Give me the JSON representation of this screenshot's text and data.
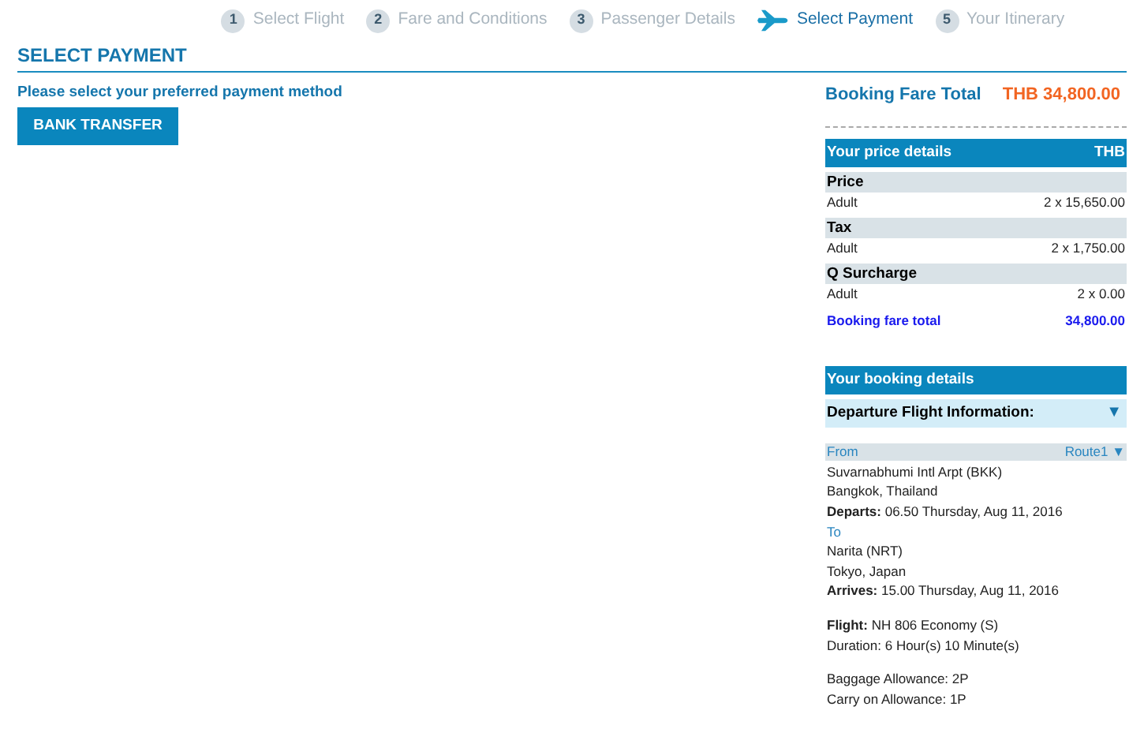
{
  "steps": [
    {
      "number": "1",
      "label": "Select Flight",
      "selected": false
    },
    {
      "number": "2",
      "label": "Fare and Conditions",
      "selected": false
    },
    {
      "number": "3",
      "label": "Passenger Details",
      "selected": false
    },
    {
      "label": "Select Payment",
      "selected": true
    },
    {
      "number": "5",
      "label": "Your Itinerary",
      "selected": false
    }
  ],
  "page_title": "SELECT PAYMENT",
  "payment": {
    "prompt": "Please select your preferred payment method",
    "buttons": [
      "BANK TRANSFER"
    ]
  },
  "booking_total": {
    "label": "Booking Fare Total",
    "amount": "THB 34,800.00"
  },
  "price_details": {
    "title": "Your price details",
    "currency": "THB",
    "groups": [
      {
        "name": "Price",
        "rows": [
          {
            "label": "Adult",
            "value": "2 x 15,650.00"
          }
        ]
      },
      {
        "name": "Tax",
        "rows": [
          {
            "label": "Adult",
            "value": "2 x 1,750.00"
          }
        ]
      },
      {
        "name": "Q Surcharge",
        "rows": [
          {
            "label": "Adult",
            "value": "2 x 0.00"
          }
        ]
      }
    ],
    "total": {
      "label": "Booking fare total",
      "value": "34,800.00"
    }
  },
  "booking_details": {
    "title": "Your booking details",
    "section": "Departure Flight Information:",
    "section_toggle": "▼",
    "from_label": "From",
    "route": "Route1 ▼",
    "blocks": [
      {
        "lines": [
          {
            "kind": "text",
            "text": "Suvarnabhumi Intl Arpt (BKK)"
          },
          {
            "kind": "text",
            "text": "Bangkok, Thailand"
          },
          {
            "kind": "text",
            "text": "**Departs:** 06.50 Thursday, Aug 11, 2016"
          },
          {
            "kind": "label",
            "text": "To"
          },
          {
            "kind": "text",
            "text": "Narita (NRT)"
          },
          {
            "kind": "text",
            "text": "Tokyo, Japan"
          },
          {
            "kind": "text",
            "text": "**Arrives:** 15.00 Thursday, Aug 11, 2016"
          }
        ]
      },
      {
        "lines": [
          {
            "kind": "text",
            "text": "**Flight:** NH 806 Economy (S)"
          },
          {
            "kind": "text",
            "text": "Duration: 6 Hour(s) 10 Minute(s)"
          }
        ]
      },
      {
        "lines": [
          {
            "kind": "text",
            "text": "Baggage Allowance: 2P"
          },
          {
            "kind": "text",
            "text": "Carry on Allowance: 1P"
          }
        ]
      }
    ]
  }
}
